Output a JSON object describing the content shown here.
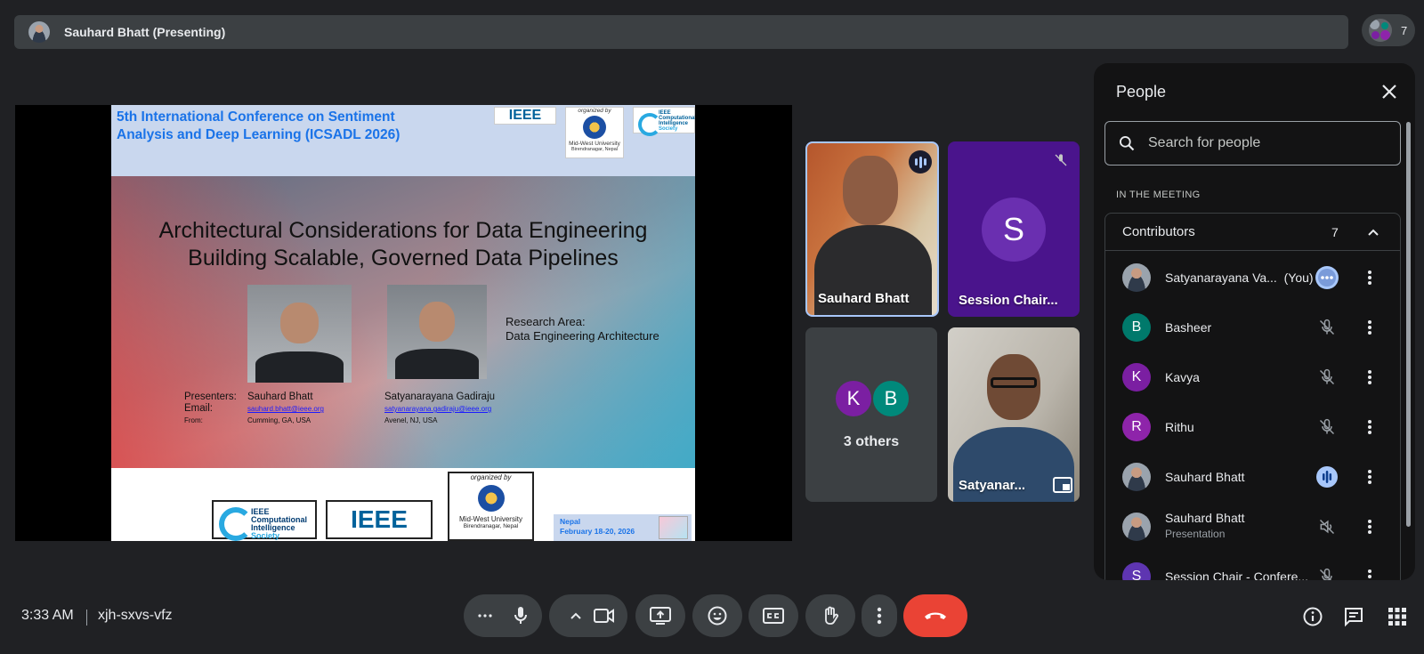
{
  "top_bar": {
    "title": "Sauhard Bhatt (Presenting)",
    "participant_count": "7"
  },
  "slide": {
    "conference_title_line1": "5th International Conference on Sentiment",
    "conference_title_line2": "Analysis and Deep Learning (ICSADL 2026)",
    "ieee": "IEEE",
    "organized_by": "organized by",
    "mwu_name": "Mid-West University",
    "mwu_location": "Birendranagar, Nepal",
    "cis_line1": "IEEE",
    "cis_line2": "Computational",
    "cis_line3": "Intelligence",
    "cis_line4": "Society",
    "talk_title_line1": "Architectural Considerations for Data Engineering",
    "talk_title_line2": "Building Scalable, Governed Data Pipelines",
    "research_label": "Research Area:",
    "research_value": "Data Engineering Architecture",
    "presenters_label": "Presenters:",
    "email_label": "Email:",
    "from_label": "From:",
    "presenter1_name": "Sauhard Bhatt",
    "presenter1_email": "sauhard.bhatt@ieee.org",
    "presenter1_from": "Cumming, GA, USA",
    "presenter2_name": "Satyanarayana Gadiraju",
    "presenter2_email": "satyanarayana.gadiraju@ieee.org",
    "presenter2_from": "Avenel, NJ, USA",
    "footer_country": "Nepal",
    "footer_dates": "February 18-20, 2026"
  },
  "tiles": {
    "sauhard": "Sauhard Bhatt",
    "chair": "Session Chair...",
    "chair_initial": "S",
    "others_initial1": "K",
    "others_initial2": "B",
    "others_label": "3 others",
    "satya": "Satyanar..."
  },
  "people_panel": {
    "title": "People",
    "search_placeholder": "Search for people",
    "section_label": "IN THE MEETING",
    "group_label": "Contributors",
    "group_count": "7",
    "people": [
      {
        "name": "Satyanarayana Va...",
        "you": "(You)",
        "initial": "",
        "color": "",
        "status": "more"
      },
      {
        "name": "Basheer",
        "initial": "B",
        "color": "#00796b",
        "status": "muted"
      },
      {
        "name": "Kavya",
        "initial": "K",
        "color": "#7b1fa2",
        "status": "muted"
      },
      {
        "name": "Rithu",
        "initial": "R",
        "color": "#8e24aa",
        "status": "muted"
      },
      {
        "name": "Sauhard Bhatt",
        "initial": "",
        "color": "",
        "status": "speaking"
      },
      {
        "name": "Sauhard Bhatt",
        "sub": "Presentation",
        "initial": "",
        "color": "",
        "status": "audio-off"
      },
      {
        "name": "Session Chair - Confere...",
        "initial": "S",
        "color": "#5e35b1",
        "status": "muted"
      }
    ]
  },
  "bottom_bar": {
    "time": "3:33 AM",
    "meeting_code": "xjh-sxvs-vfz"
  },
  "colors": {
    "background": "#202124",
    "end_call": "#ea4335",
    "accent": "#a8c7fa"
  }
}
